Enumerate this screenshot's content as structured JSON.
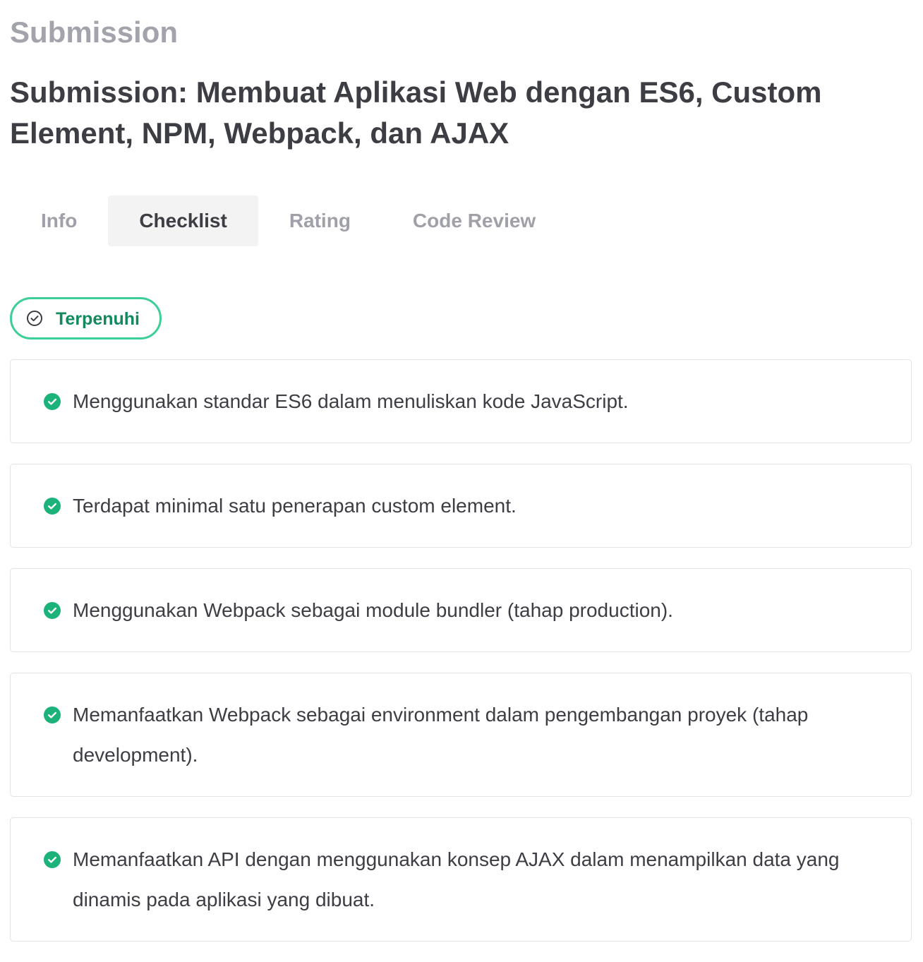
{
  "header": {
    "section_label": "Submission",
    "title": "Submission: Membuat Aplikasi Web dengan ES6, Custom Element, NPM, Webpack, dan AJAX"
  },
  "tabs": [
    {
      "label": "Info",
      "active": false
    },
    {
      "label": "Checklist",
      "active": true
    },
    {
      "label": "Rating",
      "active": false
    },
    {
      "label": "Code Review",
      "active": false
    }
  ],
  "status": {
    "label": "Terpenuhi",
    "icon": "check-circle-outline-icon",
    "color": "#3ccf97"
  },
  "checklist": {
    "icon": "check-circle-filled-icon",
    "icon_color": "#1bb37a",
    "items": [
      {
        "text": "Menggunakan standar ES6 dalam menuliskan kode JavaScript."
      },
      {
        "text": "Terdapat minimal satu penerapan custom element."
      },
      {
        "text": "Menggunakan Webpack sebagai module bundler (tahap production)."
      },
      {
        "text": "Memanfaatkan Webpack sebagai environment dalam pengembangan proyek (tahap development)."
      },
      {
        "text": "Memanfaatkan API dengan menggunakan konsep AJAX dalam menampilkan data yang dinamis pada aplikasi yang dibuat."
      }
    ]
  }
}
